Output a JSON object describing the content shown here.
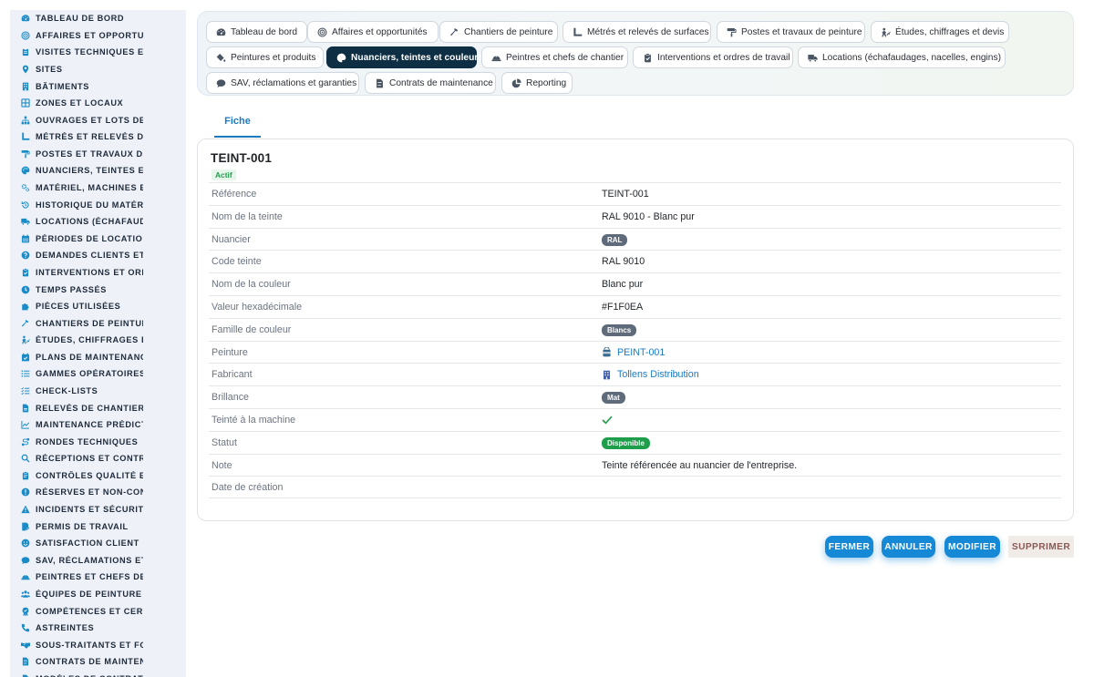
{
  "sidebar": {
    "items": [
      {
        "label": "Tableau de bord",
        "icon": "dashboard-icon"
      },
      {
        "label": "Affaires et opportunités",
        "icon": "target-icon"
      },
      {
        "label": "Visites techniques et diagnostics",
        "icon": "clipboard-icon"
      },
      {
        "label": "Sites",
        "icon": "map-pin-icon"
      },
      {
        "label": "Bâtiments",
        "icon": "building-icon"
      },
      {
        "label": "Zones et locaux",
        "icon": "layers-icon"
      },
      {
        "label": "Ouvrages et lots de travaux",
        "icon": "sitemap-icon"
      },
      {
        "label": "Métrés et relevés de surfaces",
        "icon": "ruler-icon"
      },
      {
        "label": "Postes et travaux de peinture",
        "icon": "paint-roller-icon"
      },
      {
        "label": "Nuanciers, teintes et couleurs",
        "icon": "palette-icon"
      },
      {
        "label": "Matériel, machines et équipements",
        "icon": "gears-icon"
      },
      {
        "label": "Historique du matériel",
        "icon": "history-icon"
      },
      {
        "label": "Locations (échafaudages, nacelles, engins)",
        "icon": "truck-icon"
      },
      {
        "label": "Périodes de location",
        "icon": "calendar-icon"
      },
      {
        "label": "Demandes clients et interventions",
        "icon": "question-icon"
      },
      {
        "label": "Interventions et ordres de travail",
        "icon": "clipboard-check-icon"
      },
      {
        "label": "Temps passés",
        "icon": "clock-icon"
      },
      {
        "label": "Pièces utilisées",
        "icon": "puzzle-icon"
      },
      {
        "label": "Chantiers de peinture",
        "icon": "hammer-icon"
      },
      {
        "label": "Études, chiffrages et devis",
        "icon": "person-chart-icon"
      },
      {
        "label": "Plans de maintenance",
        "icon": "calendar-check-icon"
      },
      {
        "label": "Gammes opératoires",
        "icon": "list-icon"
      },
      {
        "label": "Check-lists",
        "icon": "checklist-icon"
      },
      {
        "label": "Relevés de chantier",
        "icon": "file-icon"
      },
      {
        "label": "Maintenance prédictive",
        "icon": "line-chart-icon"
      },
      {
        "label": "Rondes techniques",
        "icon": "route-icon"
      },
      {
        "label": "Réceptions et contrôles",
        "icon": "search-icon"
      },
      {
        "label": "Contrôles qualité et essais",
        "icon": "clipboard-quality-icon"
      },
      {
        "label": "Réserves et non-conformités",
        "icon": "alert-circle-icon"
      },
      {
        "label": "Incidents et sécurité",
        "icon": "warning-icon"
      },
      {
        "label": "Permis de travail",
        "icon": "permit-icon"
      },
      {
        "label": "Satisfaction client",
        "icon": "smile-icon"
      },
      {
        "label": "SAV, réclamations et garanties",
        "icon": "comment-icon"
      },
      {
        "label": "Peintres et chefs de chantier",
        "icon": "helmet-icon"
      },
      {
        "label": "Équipes de peinture",
        "icon": "team-icon"
      },
      {
        "label": "Compétences et certifications",
        "icon": "certificate-icon"
      },
      {
        "label": "Astreintes",
        "icon": "phone-icon"
      },
      {
        "label": "Sous-traitants et fournisseurs",
        "icon": "handshake-icon"
      },
      {
        "label": "Contrats de maintenance",
        "icon": "contract-icon"
      },
      {
        "label": "Modèles de contrats",
        "icon": "template-icon"
      }
    ]
  },
  "topnav": {
    "tabs": [
      {
        "label": "Tableau de bord",
        "icon": "dashboard-icon",
        "active": false
      },
      {
        "label": "Affaires et opportunités",
        "icon": "target-icon",
        "active": false
      },
      {
        "label": "Chantiers de peinture",
        "icon": "hammer-icon",
        "active": false
      },
      {
        "label": "Métrés et relevés de surfaces",
        "icon": "ruler-icon",
        "active": false
      },
      {
        "label": "Postes et travaux de peinture",
        "icon": "paint-roller-icon",
        "active": false
      },
      {
        "label": "Études, chiffrages et devis",
        "icon": "person-chart-icon",
        "active": false
      },
      {
        "label": "Peintures et produits",
        "icon": "fill-drip-icon",
        "active": false
      },
      {
        "label": "Nuanciers, teintes et couleurs",
        "icon": "palette-icon",
        "active": true
      },
      {
        "label": "Peintres et chefs de chantier",
        "icon": "helmet-icon",
        "active": false
      },
      {
        "label": "Interventions et ordres de travail",
        "icon": "clipboard-check-icon",
        "active": false
      },
      {
        "label": "Locations (échafaudages, nacelles, engins)",
        "icon": "truck-icon",
        "active": false
      },
      {
        "label": "SAV, réclamations et garanties",
        "icon": "comment-icon",
        "active": false
      },
      {
        "label": "Contrats de maintenance",
        "icon": "contract-icon",
        "active": false
      },
      {
        "label": "Reporting",
        "icon": "pie-chart-icon",
        "active": false
      }
    ]
  },
  "detail_tab": {
    "label": "Fiche"
  },
  "record": {
    "title": "TEINT-001",
    "status": "Actif",
    "fields": [
      {
        "label": "Référence",
        "type": "text",
        "value": "TEINT-001"
      },
      {
        "label": "Nom de la teinte",
        "type": "text",
        "value": "RAL 9010 - Blanc pur"
      },
      {
        "label": "Nuancier",
        "type": "badge",
        "value": "RAL",
        "color": "#5f6b7a"
      },
      {
        "label": "Code teinte",
        "type": "text",
        "value": "RAL 9010"
      },
      {
        "label": "Nom de la couleur",
        "type": "text",
        "value": "Blanc pur"
      },
      {
        "label": "Valeur hexadécimale",
        "type": "text",
        "value": "#F1F0EA"
      },
      {
        "label": "Famille de couleur",
        "type": "badge",
        "value": "Blancs",
        "color": "#5f6b7a"
      },
      {
        "label": "Peinture",
        "type": "link",
        "value": "PEINT-001",
        "icon": "paint-bucket-icon"
      },
      {
        "label": "Fabricant",
        "type": "link",
        "value": "Tollens Distribution",
        "icon": "building-icon"
      },
      {
        "label": "Brillance",
        "type": "badge",
        "value": "Mat",
        "color": "#5f6b7a"
      },
      {
        "label": "Teinté à la machine",
        "type": "check",
        "value": "",
        "icon": "check-icon"
      },
      {
        "label": "Statut",
        "type": "badge",
        "value": "Disponible",
        "color": "#1e9e4a"
      },
      {
        "label": "Note",
        "type": "text",
        "value": "Teinte référencée au nuancier de l'entreprise."
      },
      {
        "label": "Date de création",
        "type": "text",
        "value": ""
      }
    ]
  },
  "actions": {
    "close": "Fermer",
    "cancel": "Annuler",
    "edit": "Modifier",
    "delete": "Supprimer"
  },
  "colors": {
    "accent": "#1689d6",
    "active_tab": "#0d2e43",
    "sidebar_icon": "#1a8bc7",
    "success": "#1e9e4a",
    "badge_gray": "#5f6b7a"
  }
}
